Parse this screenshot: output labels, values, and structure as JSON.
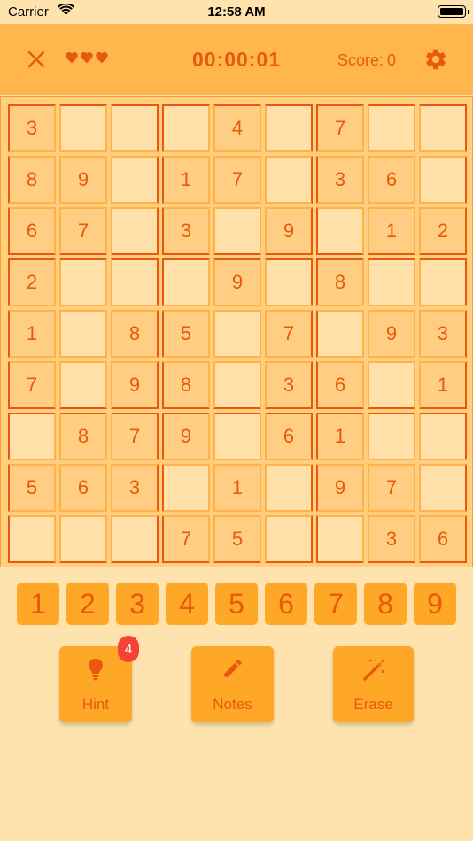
{
  "status_bar": {
    "carrier": "Carrier",
    "time": "12:58 AM"
  },
  "header": {
    "lives": 3,
    "timer": "00:00:01",
    "score_label": "Score:",
    "score_value": "0"
  },
  "colors": {
    "accent": "#E8590C",
    "header_bg": "#FFB74D",
    "page_bg": "#FFE3AE",
    "button_bg": "#FFA726",
    "badge_bg": "#F44336"
  },
  "board": {
    "rows": [
      [
        "3",
        "",
        "",
        "",
        "4",
        "",
        "7",
        "",
        ""
      ],
      [
        "8",
        "9",
        "",
        "1",
        "7",
        "",
        "3",
        "6",
        ""
      ],
      [
        "6",
        "7",
        "",
        "3",
        "",
        "9",
        "",
        "1",
        "2"
      ],
      [
        "2",
        "",
        "",
        "",
        "9",
        "",
        "8",
        "",
        ""
      ],
      [
        "1",
        "",
        "8",
        "5",
        "",
        "7",
        "",
        "9",
        "3"
      ],
      [
        "7",
        "",
        "9",
        "8",
        "",
        "3",
        "6",
        "",
        "1"
      ],
      [
        "",
        "8",
        "7",
        "9",
        "",
        "6",
        "1",
        "",
        ""
      ],
      [
        "5",
        "6",
        "3",
        "",
        "1",
        "",
        "9",
        "7",
        ""
      ],
      [
        "",
        "",
        "",
        "7",
        "5",
        "",
        "",
        "3",
        "6"
      ]
    ]
  },
  "numpad": [
    "1",
    "2",
    "3",
    "4",
    "5",
    "6",
    "7",
    "8",
    "9"
  ],
  "actions": {
    "hint": {
      "label": "Hint",
      "badge": "4",
      "icon": "lightbulb-icon"
    },
    "notes": {
      "label": "Notes",
      "icon": "pencil-icon"
    },
    "erase": {
      "label": "Erase",
      "icon": "magic-wand-icon"
    }
  }
}
